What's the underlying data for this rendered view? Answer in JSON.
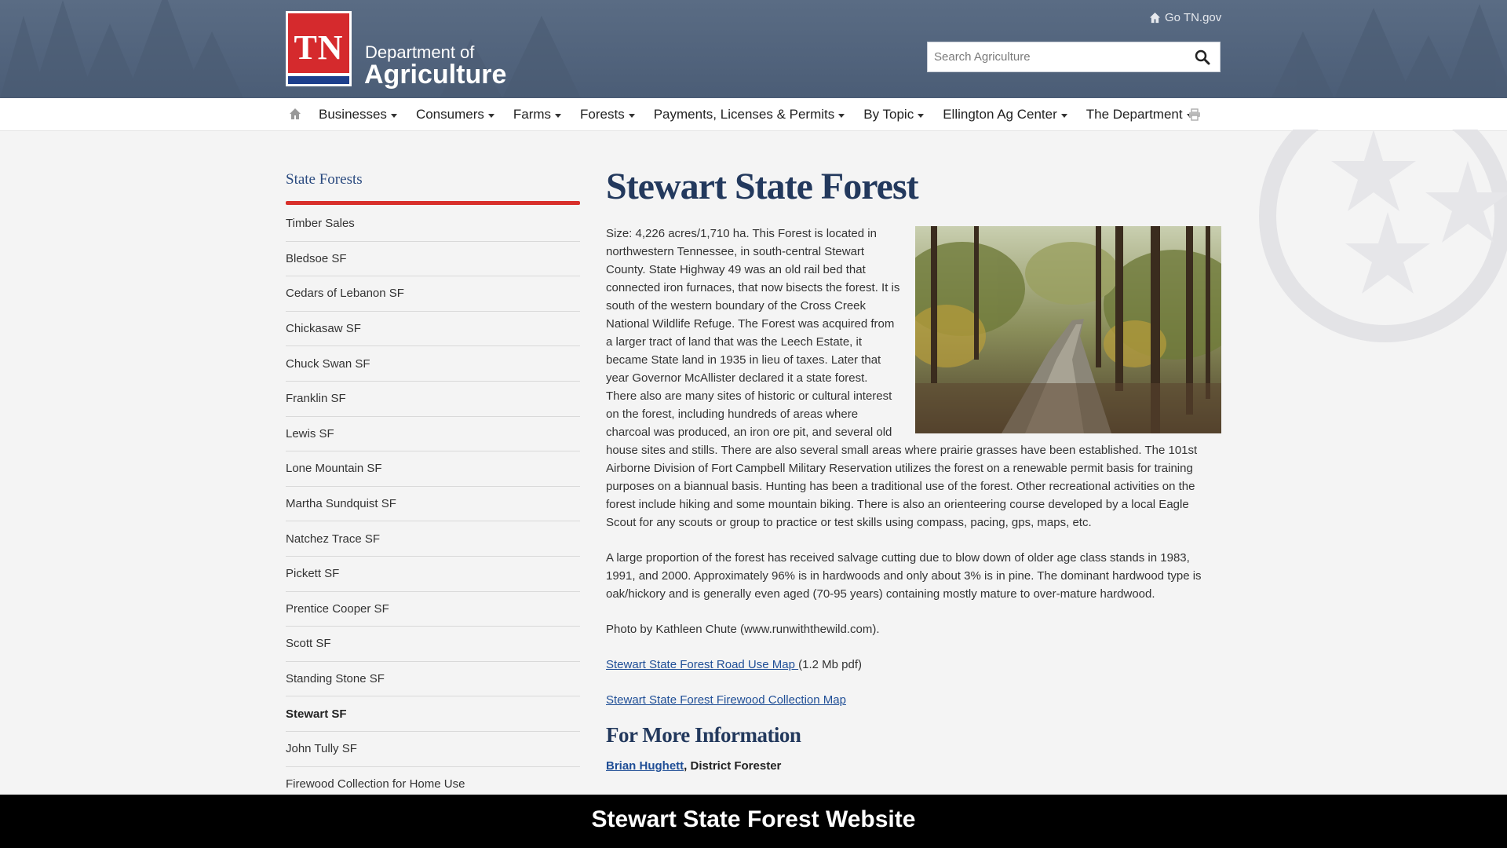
{
  "header": {
    "logo_text": "TN",
    "dept_line1": "Department of",
    "dept_line2": "Agriculture",
    "go_tn": "Go TN.gov",
    "search_placeholder": "Search Agriculture"
  },
  "nav": {
    "items": [
      "Businesses",
      "Consumers",
      "Farms",
      "Forests",
      "Payments, Licenses & Permits",
      "By Topic",
      "Ellington Ag Center",
      "The Department"
    ]
  },
  "sidebar": {
    "title": "State Forests",
    "items": [
      "Timber Sales",
      "Bledsoe SF",
      "Cedars of Lebanon SF",
      "Chickasaw SF",
      "Chuck Swan SF",
      "Franklin SF",
      "Lewis SF",
      "Lone Mountain SF",
      "Martha Sundquist SF",
      "Natchez Trace SF",
      "Pickett SF",
      "Prentice Cooper SF",
      "Scott SF",
      "Standing Stone SF",
      "Stewart SF",
      "John Tully SF",
      "Firewood Collection for Home Use"
    ],
    "active": "Stewart SF"
  },
  "main": {
    "title": "Stewart State Forest",
    "para1": "Size: 4,226 acres/1,710 ha.  This Forest is located in northwestern Tennessee, in south-central Stewart County. State Highway 49 was an old rail bed that connected iron furnaces, that now bisects the forest. It is south of the western boundary of the Cross Creek National Wildlife Refuge. The Forest was acquired from a larger tract of land that was the Leech Estate, it became State land in 1935 in lieu of taxes. Later that year Governor McAllister declared it a state forest. There also are many sites of historic or cultural interest on the forest, including hundreds of areas where charcoal was produced, an iron ore pit, and several old house sites and stills. There are also several small areas where prairie grasses have been established. The 101st Airborne Division of Fort Campbell Military Reservation utilizes the forest on a renewable permit basis for training purposes on a biannual basis. Hunting has been a traditional use of the forest. Other recreational activities on the forest include hiking and some mountain biking. There is also an orienteering course developed by a local Eagle Scout for any scouts or group to practice or test skills using compass, pacing, gps, maps, etc.",
    "para2": "A large proportion of the forest has received salvage cutting due to blow down of older age class stands in 1983, 1991, and 2000. Approximately 96% is in hardwoods and only about 3% is in pine. The dominant hardwood type is oak/hickory and is generally even aged (70-95 years) containing mostly mature to over-mature hardwood.",
    "photo_credit": "Photo by Kathleen Chute (www.runwiththewild.com).",
    "link1_text": "Stewart State Forest Road Use Map ",
    "link1_suffix": "(1.2 Mb pdf)",
    "link2_text": "Stewart State Forest Firewood Collection Map",
    "more_title": "For More Information",
    "contact_name": "Brian Hughett",
    "contact_role": ", District Forester"
  },
  "caption": "Stewart State Forest Website",
  "colors": {
    "header_bg": "#51637c",
    "logo_red": "#d52a2d",
    "accent_red": "#d8302b",
    "title_navy": "#23395d",
    "link_blue": "#1f4e96"
  }
}
